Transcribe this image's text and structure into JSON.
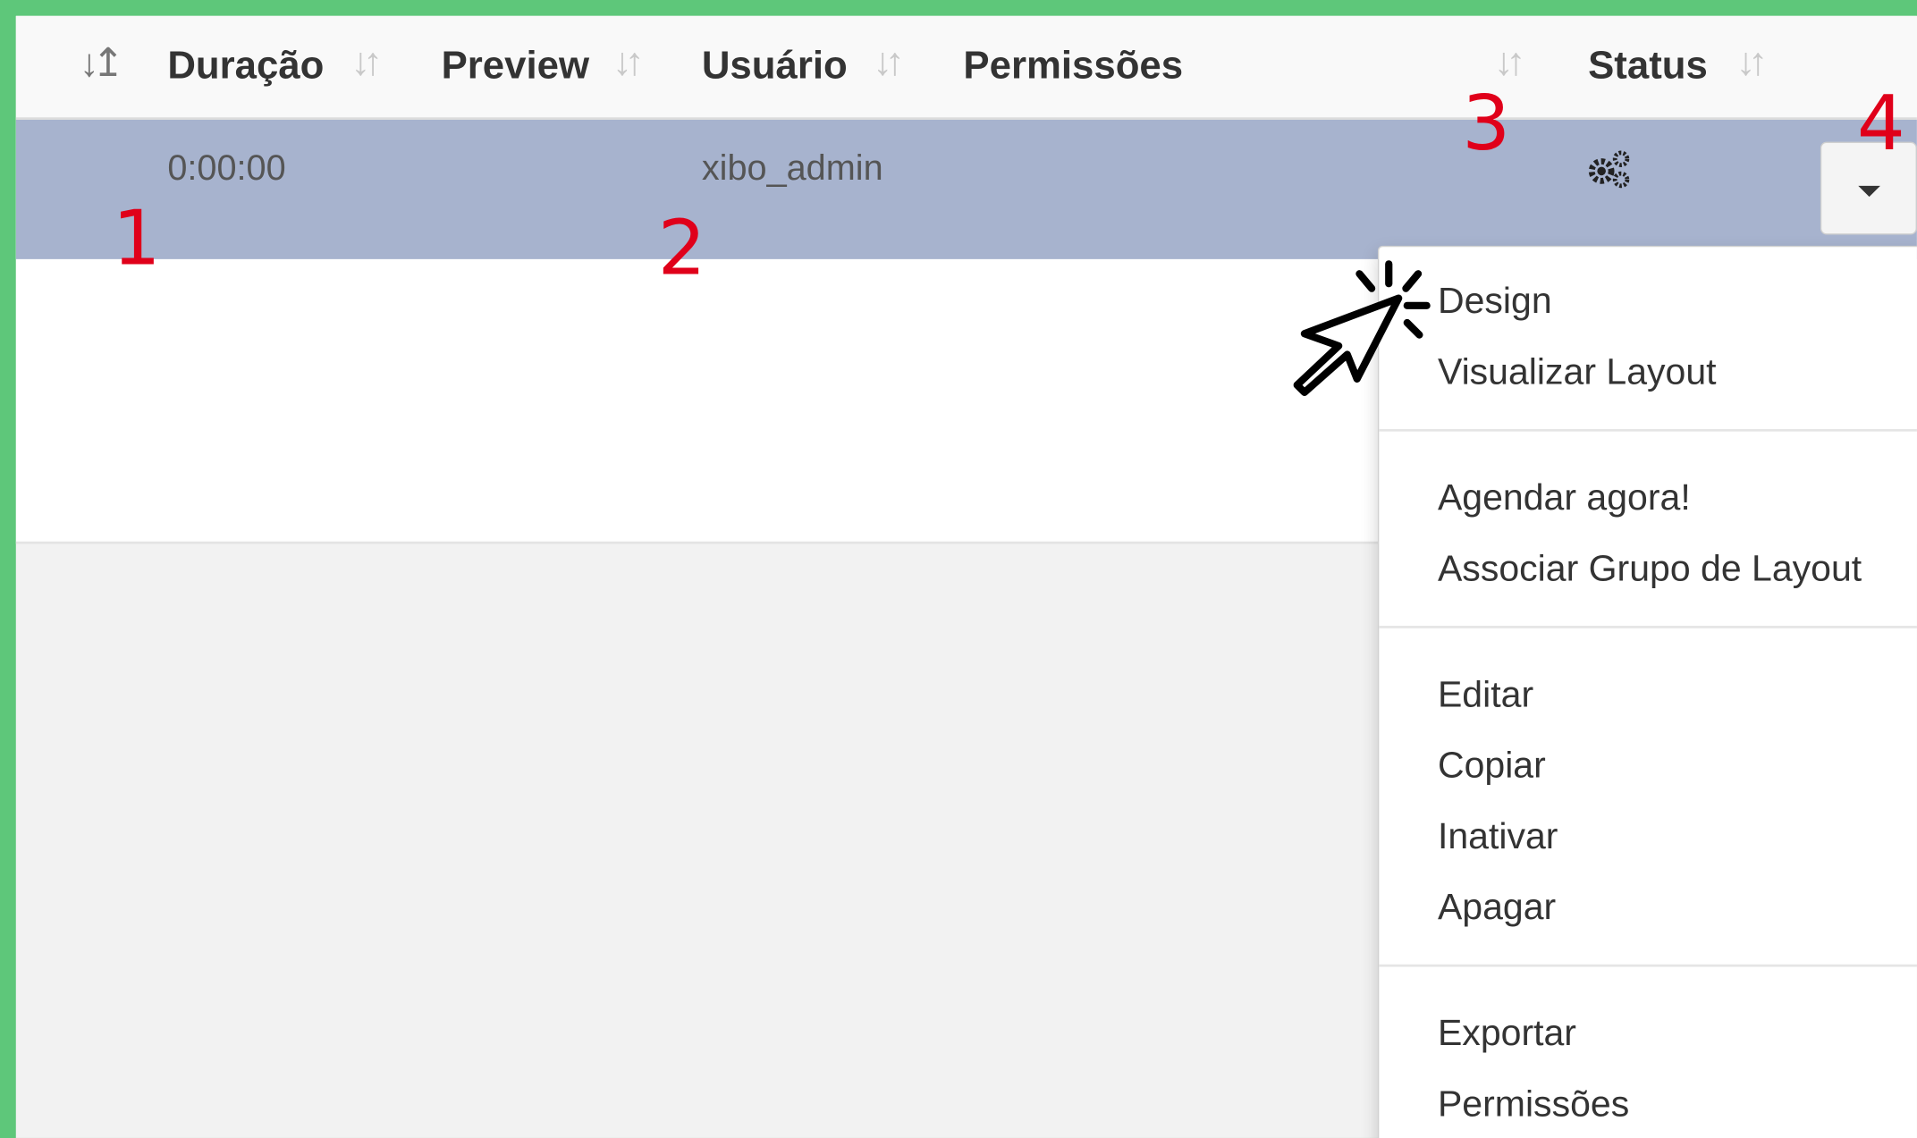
{
  "table": {
    "columns": [
      {
        "label": "Duração"
      },
      {
        "label": "Preview"
      },
      {
        "label": "Usuário"
      },
      {
        "label": "Permissões"
      },
      {
        "label": "Status"
      }
    ],
    "row": {
      "duration": "0:00:00",
      "user": "xibo_admin",
      "status_icon": "gears-icon"
    }
  },
  "menu": {
    "groups": [
      [
        "Design",
        "Visualizar Layout"
      ],
      [
        "Agendar agora!",
        "Associar Grupo de Layout"
      ],
      [
        "Editar",
        "Copiar",
        "Inativar",
        "Apagar"
      ],
      [
        "Exportar",
        "Permissões"
      ]
    ]
  },
  "annotations": [
    "1",
    "2",
    "3",
    "4"
  ],
  "icons": [
    "sort-active-icon",
    "sort-icon",
    "gears-icon",
    "caret-down-icon",
    "click-cursor-icon"
  ],
  "colors": {
    "border_green": "#5ec77a",
    "row_highlight": "#a7b3ce",
    "annotation_red": "#e0001a"
  }
}
